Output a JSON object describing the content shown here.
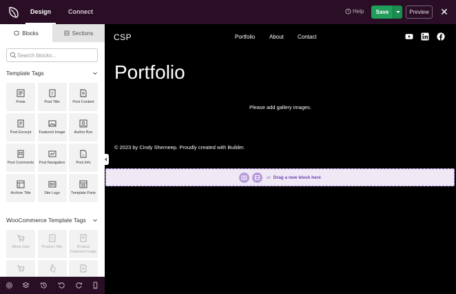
{
  "topbar": {
    "tabs": [
      {
        "label": "Design"
      },
      {
        "label": "Connect"
      }
    ],
    "help_label": "Help",
    "save_label": "Save",
    "preview_label": "Preview",
    "colors": {
      "bar": "#2a0e26",
      "save": "#1f9e5c"
    }
  },
  "sidebar": {
    "tabs": [
      {
        "label": "Blocks"
      },
      {
        "label": "Sections"
      }
    ],
    "search": {
      "placeholder": "Search blocks...",
      "value": ""
    },
    "template_tags": {
      "title": "Template Tags",
      "items": [
        {
          "label": "Posts",
          "icon": "posts-icon"
        },
        {
          "label": "Post Title",
          "icon": "post-title-icon"
        },
        {
          "label": "Post Content",
          "icon": "post-content-icon"
        },
        {
          "label": "Post Excerpt",
          "icon": "post-excerpt-icon"
        },
        {
          "label": "Featured Image",
          "icon": "featured-image-icon"
        },
        {
          "label": "Author Box",
          "icon": "author-box-icon"
        },
        {
          "label": "Post Comments",
          "icon": "post-comments-icon"
        },
        {
          "label": "Post Navigation",
          "icon": "post-navigation-icon"
        },
        {
          "label": "Post Info",
          "icon": "post-info-icon"
        },
        {
          "label": "Archive Title",
          "icon": "archive-title-icon"
        },
        {
          "label": "Site Logo",
          "icon": "site-logo-icon"
        },
        {
          "label": "Template Parts",
          "icon": "template-parts-icon"
        }
      ]
    },
    "woocommerce_tags": {
      "title": "WooCommerce Template Tags",
      "items": [
        {
          "label": "Menu Cart",
          "icon": "menu-cart-icon"
        },
        {
          "label": "Product Title",
          "icon": "product-title-icon"
        },
        {
          "label": "Product\nFeatured Image",
          "icon": "product-featured-image-icon"
        },
        {
          "label": "",
          "icon": "cart-icon"
        },
        {
          "label": "",
          "icon": "pointer-icon"
        },
        {
          "label": "",
          "icon": "document-icon"
        }
      ]
    }
  },
  "bottombar": {
    "icons": [
      "gear-icon",
      "layers-icon",
      "history-icon",
      "undo-icon",
      "redo-icon",
      "mobile-icon"
    ]
  },
  "canvas": {
    "site_title": "CSP",
    "nav": [
      "Portfolio",
      "About",
      "Contact"
    ],
    "social": [
      "youtube-icon",
      "linkedin-icon",
      "facebook-icon"
    ],
    "page_title": "Portfolio",
    "gallery_note": "Please add gallery images.",
    "footer": "© 2023 by Cindy Sherneep. Proudly created with Builder.",
    "dropzone": {
      "or": "or",
      "text": "Drag a new block here"
    }
  }
}
